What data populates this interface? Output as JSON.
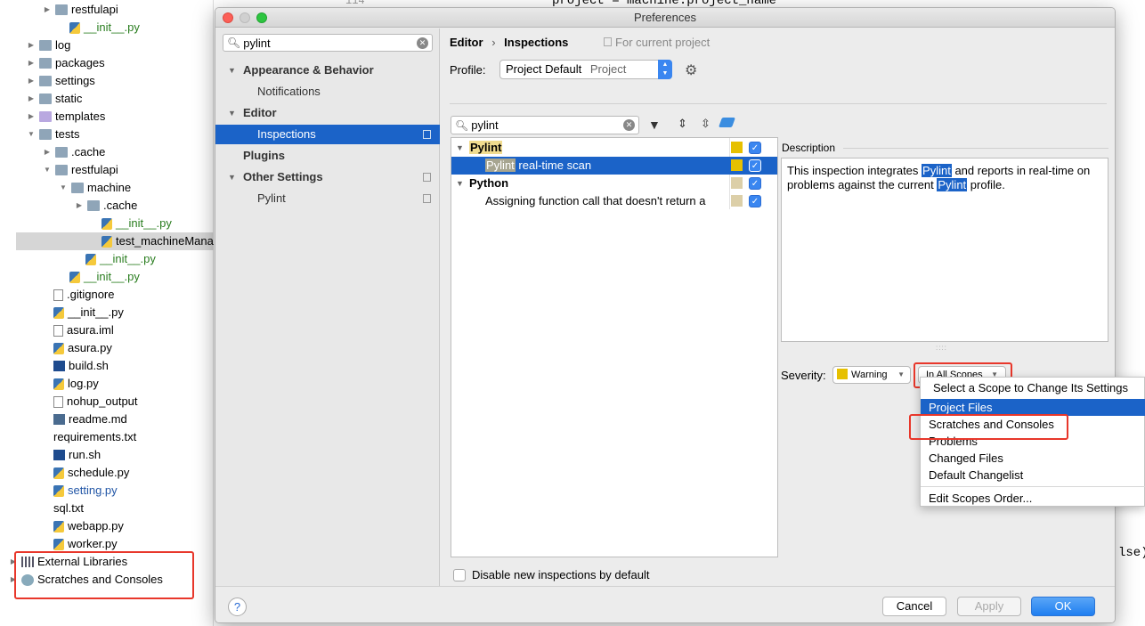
{
  "tree": {
    "items": [
      {
        "label": "restfulapi",
        "icon": "folder-icon"
      },
      {
        "label": "__init__.py",
        "icon": "python-file-icon"
      },
      {
        "label": "log",
        "icon": "folder-icon"
      },
      {
        "label": "packages",
        "icon": "folder-icon"
      },
      {
        "label": "settings",
        "icon": "folder-icon"
      },
      {
        "label": "static",
        "icon": "folder-icon"
      },
      {
        "label": "templates",
        "icon": "folder-icon"
      },
      {
        "label": "tests",
        "icon": "folder-icon"
      },
      {
        "label": ".cache",
        "icon": "folder-icon"
      },
      {
        "label": "restfulapi",
        "icon": "folder-icon"
      },
      {
        "label": "machine",
        "icon": "folder-icon"
      },
      {
        "label": ".cache",
        "icon": "folder-icon"
      },
      {
        "label": "__init__.py",
        "icon": "python-file-icon"
      },
      {
        "label": "test_machineMana",
        "icon": "python-file-icon"
      },
      {
        "label": "__init__.py",
        "icon": "python-file-icon"
      },
      {
        "label": "__init__.py",
        "icon": "python-file-icon"
      },
      {
        "label": ".gitignore",
        "icon": "file-icon"
      },
      {
        "label": "__init__.py",
        "icon": "python-file-icon"
      },
      {
        "label": "asura.iml",
        "icon": "file-icon"
      },
      {
        "label": "asura.py",
        "icon": "python-file-icon"
      },
      {
        "label": "build.sh",
        "icon": "shell-file-icon"
      },
      {
        "label": "log.py",
        "icon": "python-file-icon"
      },
      {
        "label": "nohup_output",
        "icon": "file-icon"
      },
      {
        "label": "readme.md",
        "icon": "markdown-file-icon"
      },
      {
        "label": "requirements.txt",
        "icon": "file-icon"
      },
      {
        "label": "run.sh",
        "icon": "shell-file-icon"
      },
      {
        "label": "schedule.py",
        "icon": "python-file-icon"
      },
      {
        "label": "setting.py",
        "icon": "python-file-icon"
      },
      {
        "label": "sql.txt",
        "icon": "file-icon"
      },
      {
        "label": "webapp.py",
        "icon": "python-file-icon"
      },
      {
        "label": "worker.py",
        "icon": "python-file-icon"
      },
      {
        "label": "External Libraries",
        "icon": "library-icon"
      },
      {
        "label": "Scratches and Consoles",
        "icon": "scratches-icon"
      }
    ]
  },
  "editor": {
    "line_top": "project = machine.project_name",
    "line_num": "114",
    "right_fragment": "lse)"
  },
  "dialog": {
    "title": "Preferences",
    "search_value": "pylint",
    "nav": [
      {
        "label": "Appearance & Behavior"
      },
      {
        "label": "Notifications"
      },
      {
        "label": "Editor"
      },
      {
        "label": "Inspections"
      },
      {
        "label": "Plugins"
      },
      {
        "label": "Other Settings"
      },
      {
        "label": "Pylint"
      }
    ],
    "breadcrumb": {
      "parent": "Editor",
      "sep": "›",
      "current": "Inspections",
      "scope_note": "For current project"
    },
    "profile_label": "Profile:",
    "profile_value": "Project Default",
    "profile_suffix": "Project",
    "filter_value": "pylint",
    "inspections": [
      {
        "label": "Pylint",
        "color": "#e6c000"
      },
      {
        "label": "Pylint",
        "label2": " real-time scan",
        "color": "#e6c000"
      },
      {
        "label": "Python",
        "color": "#dccfa8"
      },
      {
        "label": "Assigning function call that doesn't return a",
        "color": "#dccfa8"
      }
    ],
    "description_label": "Description",
    "description": {
      "p1": "This inspection integrates ",
      "hl1": "Pylint",
      "p2": " and reports in real-time on problems against the current ",
      "hl2": "Pylint",
      "p3": " profile."
    },
    "severity_label": "Severity:",
    "severity_value": "Warning",
    "severity_color": "#e6c000",
    "scope_value": "In All Scopes",
    "disable_new": "Disable new inspections by default",
    "buttons": {
      "help": "?",
      "cancel": "Cancel",
      "apply": "Apply",
      "ok": "OK"
    }
  },
  "popup": {
    "title": "Select a Scope to Change Its Settings",
    "items": [
      "Project Files",
      "Scratches and Consoles",
      "Problems",
      "Changed Files",
      "Default Changelist"
    ],
    "edit_order": "Edit Scopes Order..."
  }
}
